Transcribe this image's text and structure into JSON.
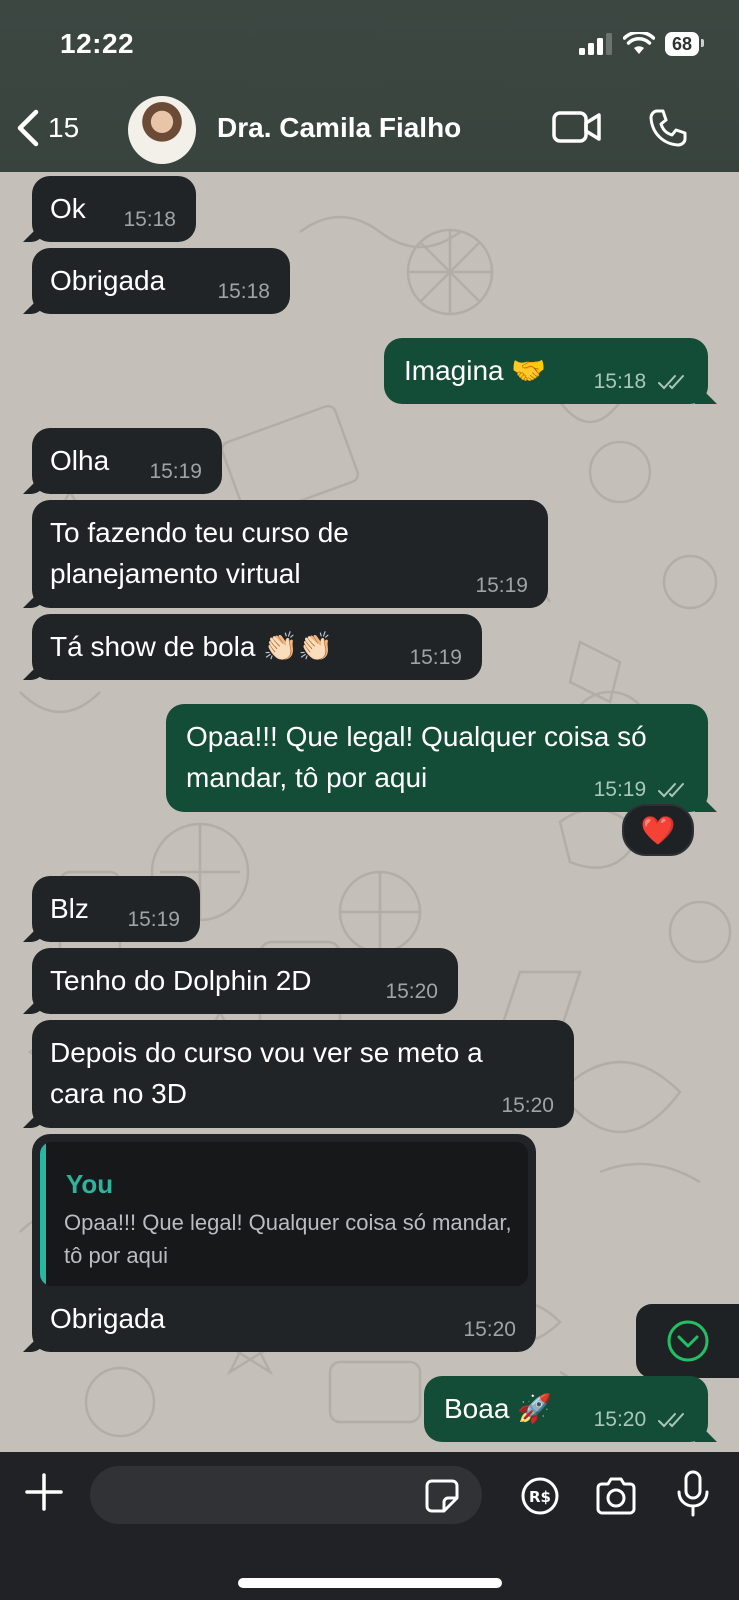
{
  "status_bar": {
    "time": "12:22",
    "battery": "68"
  },
  "header": {
    "back_count": "15",
    "contact_name": "Dra. Camila Fialho"
  },
  "messages": [
    {
      "dir": "in",
      "text": "Ok",
      "time": "15:18"
    },
    {
      "dir": "in",
      "text": "Obrigada",
      "time": "15:18"
    },
    {
      "dir": "out",
      "text": "Imagina 🤝",
      "time": "15:18"
    },
    {
      "dir": "in",
      "text": "Olha",
      "time": "15:19"
    },
    {
      "dir": "in",
      "text": "To fazendo teu curso de planejamento virtual",
      "time": "15:19"
    },
    {
      "dir": "in",
      "text": "Tá show de bola 👏🏻👏🏻",
      "time": "15:19"
    },
    {
      "dir": "out",
      "text": "Opaa!!! Que legal! Qualquer coisa só mandar, tô por aqui",
      "time": "15:19",
      "reaction": "❤️"
    },
    {
      "dir": "in",
      "text": "Blz",
      "time": "15:19"
    },
    {
      "dir": "in",
      "text": "Tenho do Dolphin 2D",
      "time": "15:20"
    },
    {
      "dir": "in",
      "text": "Depois do curso vou ver se meto a cara no 3D",
      "time": "15:20"
    },
    {
      "dir": "in",
      "text": "Obrigada",
      "time": "15:20",
      "quote": {
        "author": "You",
        "text": "Opaa!!! Que legal! Qualquer coisa só mandar, tô por aqui"
      }
    },
    {
      "dir": "out",
      "text": "Boaa 🚀",
      "time": "15:20"
    }
  ],
  "composer": {
    "placeholder": ""
  },
  "colors": {
    "incoming_bubble": "#212427",
    "outgoing_bubble": "#144d37",
    "quote_accent": "#27b8a3",
    "chat_background": "#c4c0b9"
  },
  "icons": [
    "back-chevron-icon",
    "video-call-icon",
    "phone-icon",
    "plus-icon",
    "sticker-icon",
    "payment-icon",
    "camera-icon",
    "microphone-icon",
    "read-ticks-icon",
    "scroll-down-icon"
  ]
}
